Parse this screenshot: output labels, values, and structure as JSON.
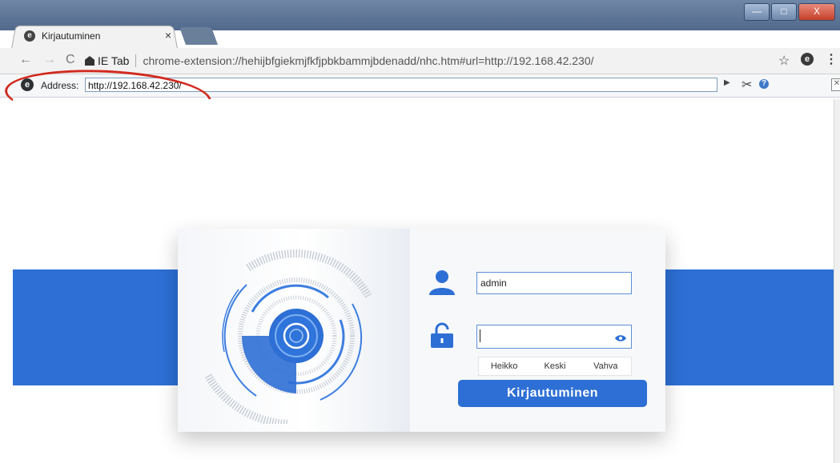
{
  "top_caption": "",
  "browser": {
    "tab": {
      "title": "Kirjautuminen",
      "close": "×",
      "favicon": "e-icon"
    },
    "toolbar": {
      "back": "←",
      "forward": "→",
      "reload": "C",
      "ext_label": "IE Tab",
      "url": "chrome-extension://hehijbfgiekmjfkfjpbkbammjbdenadd/nhc.htm#url=http://192.168.42.230/",
      "star": "☆",
      "ext_icon": "e",
      "menu": "⋮"
    },
    "iebar": {
      "address_label": "Address:",
      "address_value": "http://192.168.42.230/",
      "go": "▶",
      "tools": "✂",
      "help": "?",
      "close": "✕"
    },
    "window_controls": {
      "min": "—",
      "max": "□",
      "close": "X"
    }
  },
  "login": {
    "username_value": "admin",
    "password_value": "",
    "strength": [
      "Heikko",
      "Keski",
      "Vahva"
    ],
    "submit_label": "Kirjautuminen",
    "accent": "#2d6fd5"
  }
}
